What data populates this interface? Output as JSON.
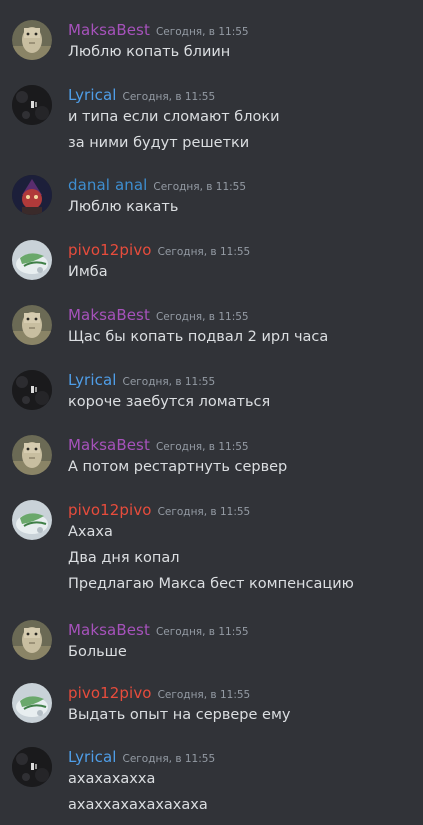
{
  "colors": {
    "maksa": "#a652bb",
    "lyrical": "#4f9ee8",
    "danal": "#3e8ed0",
    "pivo": "#e74c3c"
  },
  "messages": [
    {
      "author": "MaksaBest",
      "color": "maksa",
      "avatar": "maksa-avatar",
      "time": "Сегодня, в 11:55",
      "lines": [
        "Люблю копать блиин"
      ]
    },
    {
      "author": "Lyrical",
      "color": "lyrical",
      "avatar": "lyrical-avatar",
      "time": "Сегодня, в 11:55",
      "lines": [
        "и типа если сломают блоки",
        "за ними будут решетки"
      ]
    },
    {
      "author": "danal anal",
      "color": "danal",
      "avatar": "danal-avatar",
      "time": "Сегодня, в 11:55",
      "lines": [
        "Люблю какать"
      ]
    },
    {
      "author": "pivo12pivo",
      "color": "pivo",
      "avatar": "pivo-avatar",
      "time": "Сегодня, в 11:55",
      "lines": [
        "Имба"
      ]
    },
    {
      "author": "MaksaBest",
      "color": "maksa",
      "avatar": "maksa-avatar",
      "time": "Сегодня, в 11:55",
      "lines": [
        "Щас бы копать подвал 2 ирл часа"
      ]
    },
    {
      "author": "Lyrical",
      "color": "lyrical",
      "avatar": "lyrical-avatar",
      "time": "Сегодня, в 11:55",
      "lines": [
        "короче заебутся ломаться"
      ]
    },
    {
      "author": "MaksaBest",
      "color": "maksa",
      "avatar": "maksa-avatar",
      "time": "Сегодня, в 11:55",
      "lines": [
        "А потом рестартнуть сервер"
      ]
    },
    {
      "author": "pivo12pivo",
      "color": "pivo",
      "avatar": "pivo-avatar",
      "time": "Сегодня, в 11:55",
      "lines": [
        "Ахаха",
        "Два дня копал",
        "Предлагаю Макса бест компенсацию"
      ]
    },
    {
      "author": "MaksaBest",
      "color": "maksa",
      "avatar": "maksa-avatar",
      "time": "Сегодня, в 11:55",
      "lines": [
        "Больше"
      ]
    },
    {
      "author": "pivo12pivo",
      "color": "pivo",
      "avatar": "pivo-avatar",
      "time": "Сегодня, в 11:55",
      "lines": [
        "Выдать опыт на сервере ему"
      ]
    },
    {
      "author": "Lyrical",
      "color": "lyrical",
      "avatar": "lyrical-avatar",
      "time": "Сегодня, в 11:55",
      "lines": [
        "ахахахахха",
        "ахаххахахахахаха"
      ]
    }
  ]
}
